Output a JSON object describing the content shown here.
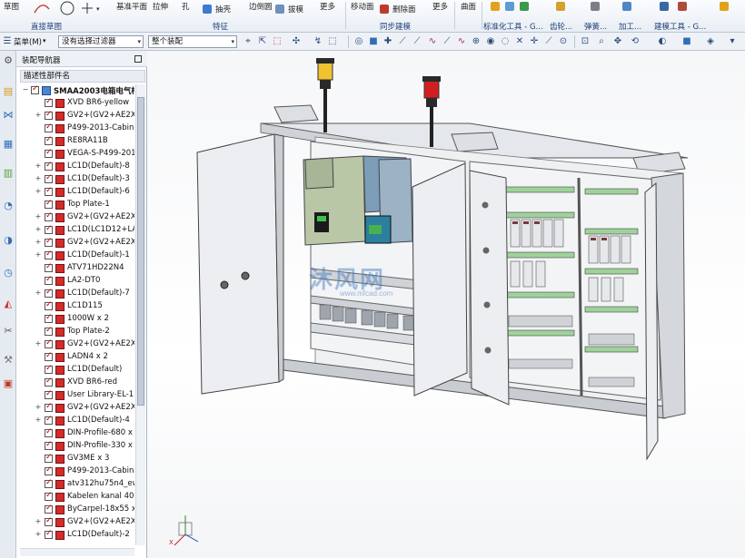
{
  "ribbon": {
    "items": [
      "草图",
      "基准平面",
      "拉伸",
      "孔",
      "抽壳",
      "边倒圆",
      "拔模",
      "更多",
      "移动面",
      "删除面",
      "更多",
      "曲面"
    ],
    "groups": [
      "直接草图",
      "特征",
      "同步建模",
      "标准化工具 - G...",
      "齿轮...",
      "弹簧...",
      "加工...",
      "建模工具 - G..."
    ]
  },
  "toolbar": {
    "menu_label": "菜单(M)",
    "filter_combo": "没有选择过滤器",
    "assembly_combo": "整个装配"
  },
  "navigator": {
    "title": "装配导航器",
    "column_header": "描述性部件名",
    "root_label": "SMAA2003电箱电气柜",
    "items": [
      "XVD BR6-yellow",
      "GV2+(GV2+AE2X",
      "P499-2013-Cabin",
      "RE8RA11B",
      "VEGA-S-P499-201",
      "LC1D(Default)-8",
      "LC1D(Default)-3",
      "LC1D(Default)-6",
      "Top Plate-1",
      "GV2+(GV2+AE2X",
      "LC1D(LC1D12+LA",
      "GV2+(GV2+AE2X",
      "LC1D(Default)-1",
      "ATV71HD22N4",
      "LA2-DT0",
      "LC1D(Default)-7",
      "LC1D115",
      "1000W x 2",
      "Top Plate-2",
      "GV2+(GV2+AE2X",
      "LADN4 x 2",
      "LC1D(Default)",
      "XVD BR6-red",
      "User Library-EL-1",
      "GV2+(GV2+AE2X",
      "LC1D(Default)-4",
      "DIN-Profile-680 x",
      "DIN-Profile-330 x",
      "GV3ME x 3",
      "P499-2013-Cabine",
      "atv312hu75n4_ew",
      "Kabelen kanal 40",
      "ByCarpel-18x55 x",
      "GV2+(GV2+AE2X",
      "LC1D(Default)-2"
    ]
  },
  "viewport": {
    "watermark": "沐风网",
    "watermark_url": "www.mfcad.com"
  },
  "colors": {
    "accent": "#1d3f76",
    "check": "#c00000",
    "component": "#d12b2b"
  }
}
